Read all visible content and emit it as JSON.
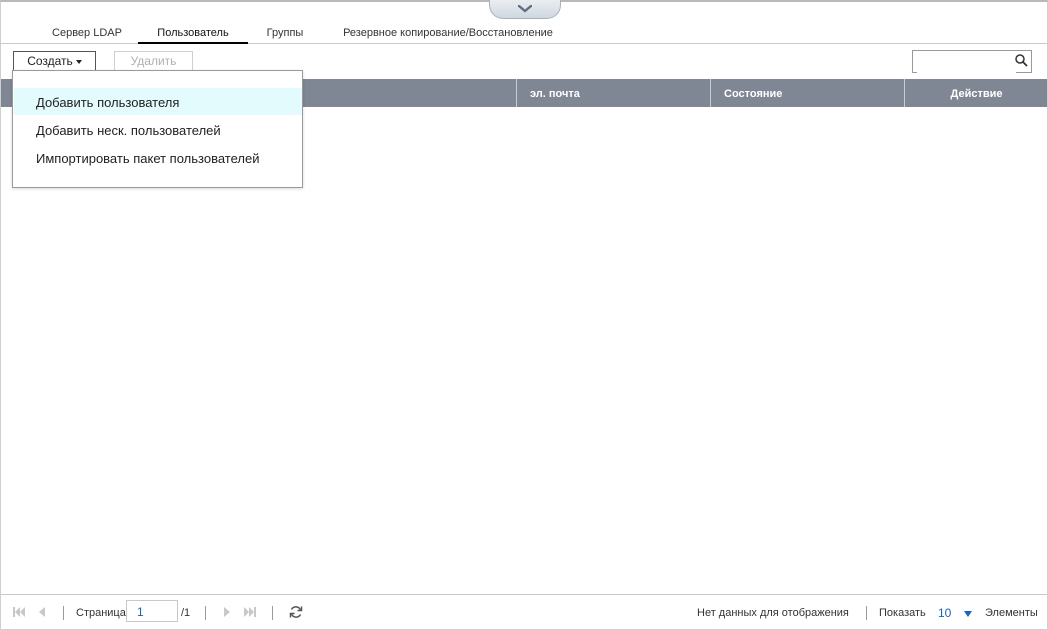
{
  "tabs": [
    {
      "label": "Сервер LDAP",
      "active": false
    },
    {
      "label": "Пользователь",
      "active": true
    },
    {
      "label": "Группы",
      "active": false
    },
    {
      "label": "Резервное копирование/Восстановление",
      "active": false
    }
  ],
  "toolbar": {
    "create_label": "Создать",
    "delete_label": "Удалить",
    "search_placeholder": ""
  },
  "dropdown": {
    "items": [
      {
        "label": "Добавить пользователя",
        "highlighted": true
      },
      {
        "label": "Добавить неск. пользователей",
        "highlighted": false
      },
      {
        "label": "Импортировать пакет пользователей",
        "highlighted": false
      }
    ]
  },
  "table": {
    "columns": [
      "",
      "эл. почта",
      "Состояние",
      "Действие"
    ],
    "rows": []
  },
  "footer": {
    "page_label": "Страница",
    "page_value": "1",
    "page_total": "/1",
    "no_data": "Нет данных для отображения",
    "show_label": "Показать",
    "show_value": "10",
    "items_label": "Элементы"
  },
  "colors": {
    "header_bg": "#7f8794",
    "highlight_bg": "#e3fbfd",
    "accent": "#1a63b8"
  },
  "icons": {
    "collapse": "chevron-down-icon",
    "search": "search-icon",
    "refresh": "refresh-icon"
  }
}
